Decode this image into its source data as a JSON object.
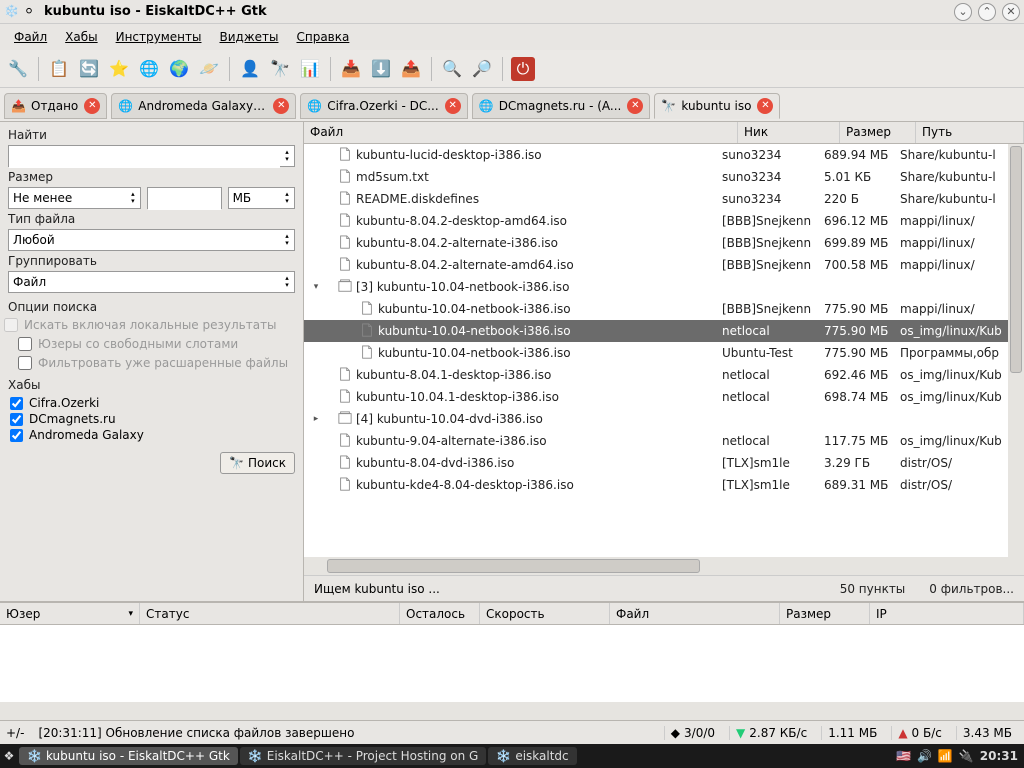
{
  "window": {
    "title": "kubuntu iso - EiskaltDC++ Gtk"
  },
  "menubar": {
    "items": [
      "Файл",
      "Хабы",
      "Инструменты",
      "Виджеты",
      "Справка"
    ]
  },
  "tabs": [
    {
      "label": "Отдано",
      "icon": "upload"
    },
    {
      "label": "Andromeda Galaxy ...",
      "icon": "hub"
    },
    {
      "label": "Cifra.Ozerki - DC...",
      "icon": "hub"
    },
    {
      "label": "DCmagnets.ru - (A...",
      "icon": "hub"
    },
    {
      "label": "kubuntu iso",
      "icon": "search",
      "active": true
    }
  ],
  "left": {
    "find_label": "Найти",
    "find_value": "",
    "size_label": "Размер",
    "size_mode": "Не менее",
    "size_value": "",
    "size_unit": "МБ",
    "type_label": "Тип файла",
    "type_value": "Любой",
    "group_label": "Группировать",
    "group_value": "Файл",
    "opts_label": "Опции поиска",
    "opt1": "Искать включая локальные результаты",
    "opt2": "Юзеры со свободными слотами",
    "opt3": "Фильтровать уже расшаренные файлы",
    "hubs_label": "Хабы",
    "hubs": [
      "Cifra.Ozerki",
      "DCmagnets.ru",
      "Andromeda Galaxy"
    ],
    "search_btn": "Поиск"
  },
  "cols": {
    "file": "Файл",
    "nick": "Ник",
    "size": "Размер",
    "path": "Путь"
  },
  "rows": [
    {
      "indent": 0,
      "icon": "iso",
      "name": "kubuntu-lucid-desktop-i386.iso",
      "nick": "suno3234",
      "size": "689.94 МБ",
      "path": "Share/kubuntu-l"
    },
    {
      "indent": 0,
      "icon": "txt",
      "name": "md5sum.txt",
      "nick": "suno3234",
      "size": "5.01 КБ",
      "path": "Share/kubuntu-l"
    },
    {
      "indent": 0,
      "icon": "txt",
      "name": "README.diskdefines",
      "nick": "suno3234",
      "size": "220 Б",
      "path": "Share/kubuntu-l"
    },
    {
      "indent": 0,
      "icon": "iso",
      "name": "kubuntu-8.04.2-desktop-amd64.iso",
      "nick": "[BBB]Snejkenn",
      "size": "696.12 МБ",
      "path": "mappi/linux/"
    },
    {
      "indent": 0,
      "icon": "iso",
      "name": "kubuntu-8.04.2-alternate-i386.iso",
      "nick": "[BBB]Snejkenn",
      "size": "699.89 МБ",
      "path": "mappi/linux/"
    },
    {
      "indent": 0,
      "icon": "iso",
      "name": "kubuntu-8.04.2-alternate-amd64.iso",
      "nick": "[BBB]Snejkenn",
      "size": "700.58 МБ",
      "path": "mappi/linux/"
    },
    {
      "indent": 0,
      "expand": "down",
      "icon": "grp",
      "name": "[3] kubuntu-10.04-netbook-i386.iso",
      "nick": "",
      "size": "",
      "path": ""
    },
    {
      "indent": 1,
      "icon": "iso",
      "name": "kubuntu-10.04-netbook-i386.iso",
      "nick": "[BBB]Snejkenn",
      "size": "775.90 МБ",
      "path": "mappi/linux/"
    },
    {
      "indent": 1,
      "icon": "iso",
      "name": "kubuntu-10.04-netbook-i386.iso",
      "nick": "netlocal",
      "size": "775.90 МБ",
      "path": "os_img/linux/Kub",
      "selected": true
    },
    {
      "indent": 1,
      "icon": "iso",
      "name": "kubuntu-10.04-netbook-i386.iso",
      "nick": "Ubuntu-Test",
      "size": "775.90 МБ",
      "path": "Программы,обр"
    },
    {
      "indent": 0,
      "icon": "iso",
      "name": "kubuntu-8.04.1-desktop-i386.iso",
      "nick": "netlocal",
      "size": "692.46 МБ",
      "path": "os_img/linux/Kub"
    },
    {
      "indent": 0,
      "icon": "iso",
      "name": "kubuntu-10.04.1-desktop-i386.iso",
      "nick": "netlocal",
      "size": "698.74 МБ",
      "path": "os_img/linux/Kub"
    },
    {
      "indent": 0,
      "expand": "right",
      "icon": "grp",
      "name": "[4] kubuntu-10.04-dvd-i386.iso",
      "nick": "",
      "size": "",
      "path": ""
    },
    {
      "indent": 0,
      "icon": "iso",
      "name": "kubuntu-9.04-alternate-i386.iso",
      "nick": "netlocal",
      "size": "117.75 МБ",
      "path": "os_img/linux/Kub"
    },
    {
      "indent": 0,
      "icon": "iso",
      "name": "kubuntu-8.04-dvd-i386.iso",
      "nick": "[TLX]sm1le",
      "size": "3.29 ГБ",
      "path": "distr/OS/"
    },
    {
      "indent": 0,
      "icon": "iso",
      "name": "kubuntu-kde4-8.04-desktop-i386.iso",
      "nick": "[TLX]sm1le",
      "size": "689.31 МБ",
      "path": "distr/OS/"
    }
  ],
  "status": {
    "left": "Ищем kubuntu iso ...",
    "count": "50 пункты",
    "filters": "0 фильтров..."
  },
  "transfers": {
    "cols": [
      "Юзер",
      "Статус",
      "Осталось",
      "Скорость",
      "Файл",
      "Размер",
      "IP"
    ]
  },
  "appstatus": {
    "toggle": "+/-",
    "log": "[20:31:11] Обновление списка файлов завершено",
    "slots": "3/0/0",
    "speed_dn": "2.87 КБ/с",
    "total_dn": "1.11 МБ",
    "speed_up": "0 Б/с",
    "total_up": "3.43 МБ"
  },
  "taskbar": {
    "tasks": [
      {
        "label": "kubuntu iso - EiskaltDC++ Gtk",
        "active": true
      },
      {
        "label": "EiskaltDC++ - Project Hosting on G"
      },
      {
        "label": "eiskaltdc"
      }
    ],
    "clock": "20:31"
  }
}
